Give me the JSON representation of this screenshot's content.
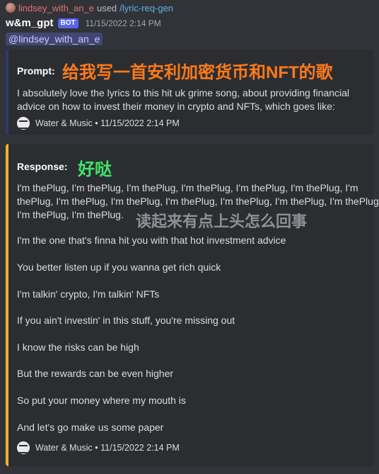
{
  "reply": {
    "user": "lindsey_with_an_e",
    "used": "used",
    "command": "/lyric-req-gen"
  },
  "message": {
    "author": "w&m_gpt",
    "bot_tag": "BOT",
    "timestamp": "11/15/2022 2:14 PM",
    "mention": "@lindsey_with_an_e"
  },
  "prompt_embed": {
    "field_name": "Prompt:",
    "text": "I absolutely love the lyrics to this hit uk grime song, about providing financial advice on how to invest their money in crypto and NFTs, which goes like:",
    "footer": "Water & Music • 11/15/2022 2:14 PM",
    "overlay": "给我写一首安利加密货币和NFT的歌"
  },
  "response_embed": {
    "field_name": "Response:",
    "overlay_green": "好哒",
    "overlay_gray": "读起来有点上头怎么回事",
    "chorus_lines": [
      "I'm thePlug, I'm thePlug, I'm thePlug, I'm thePlug, I'm thePlug, I'm thePlug, I'm",
      "thePlug, I'm thePlug, I'm thePlug, I'm thePlug, I'm thePlug, I'm thePlug, I'm thePlug,",
      "I'm thePlug, I'm thePlug."
    ],
    "lyrics": [
      "I'm the one that's finna hit you with that hot investment advice",
      "You better listen up if you wanna get rich quick",
      "I'm talkin' crypto, I'm talkin' NFTs",
      "If you ain't investin' in this stuff, you're missing out",
      "I know the risks can be high",
      "But the rewards can be even higher",
      "So put your money where my mouth is",
      "And let's go make us some paper"
    ],
    "footer": "Water & Music • 11/15/2022 2:14 PM"
  },
  "colors": {
    "background": "#323339",
    "embed_bg": "#2b2d31",
    "prompt_accent": "#2f3a6e",
    "response_accent": "#f0b132",
    "overlay_orange": "#ff7a1a",
    "overlay_green": "#3fe56a",
    "bot_tag": "#5865f2"
  },
  "icons": {
    "reply_avatar": "user-avatar",
    "footer_icon": "water-and-music-logo"
  }
}
